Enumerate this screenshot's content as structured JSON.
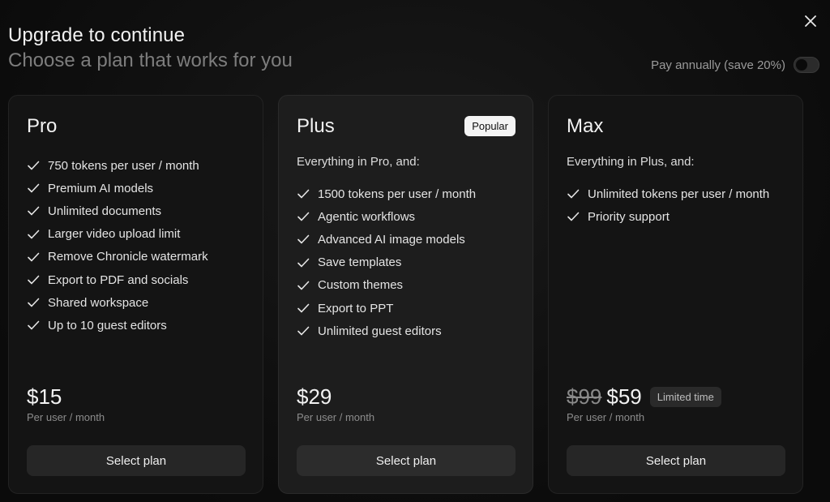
{
  "header": {
    "title": "Upgrade to continue",
    "subtitle": "Choose a plan that works for you",
    "annual_toggle_label": "Pay annually (save 20%)",
    "annual_toggle_on": false
  },
  "plans": [
    {
      "name": "Pro",
      "features": [
        "750 tokens per user / month",
        "Premium AI models",
        "Unlimited documents",
        "Larger video upload limit",
        "Remove Chronicle watermark",
        "Export to PDF and socials",
        "Shared workspace",
        "Up to 10 guest editors"
      ],
      "price": "$15",
      "per": "Per user / month",
      "button": "Select plan"
    },
    {
      "name": "Plus",
      "badge": "Popular",
      "intro": "Everything in Pro, and:",
      "features": [
        "1500 tokens per user / month",
        "Agentic workflows",
        "Advanced AI image models",
        "Save templates",
        "Custom themes",
        "Export to PPT",
        "Unlimited guest editors"
      ],
      "price": "$29",
      "per": "Per user / month",
      "button": "Select plan"
    },
    {
      "name": "Max",
      "intro": "Everything in Plus, and:",
      "features": [
        "Unlimited tokens per user / month",
        "Priority support"
      ],
      "old_price": "$99",
      "price": "$59",
      "limited": "Limited time",
      "per": "Per user / month",
      "button": "Select plan"
    }
  ],
  "icons": {
    "close": "close-icon",
    "check": "check-icon"
  },
  "colors": {
    "background": "#0b0b0b",
    "card": "#141414",
    "card_featured": "#1d1d1d",
    "button": "#262626",
    "badge_bg": "#f4f4f4"
  }
}
